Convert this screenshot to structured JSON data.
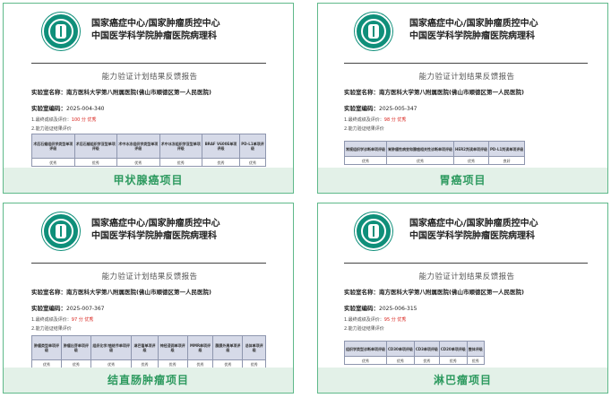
{
  "header": {
    "line1": "国家癌症中心/国家肿瘤质控中心",
    "line2": "中国医学科学院肿瘤医院病理科"
  },
  "report_title": "能力验证计划结果反馈报告",
  "cards": [
    {
      "lab_label": "实验室名称：",
      "lab_name": "南方医科大学第八附属医院(佛山市顺德区第一人民医院)",
      "code_label": "实验室编码：",
      "code": "2025-004-340",
      "score_prefix": "1.最终成绩及评价：",
      "score": "100 分 优秀",
      "eval_label": "2.能力验证结果评价",
      "headers": [
        "术后石蜡组织学类型单项评级",
        "术后石蜡组织学亚型单项评级",
        "术中冰冻组织学类型单项评级",
        "术中冰冻组织学亚型单项评级",
        "BRAF V600E单项评级",
        "PD-L1单项评级"
      ],
      "values": [
        "优秀",
        "优秀",
        "优秀",
        "优秀",
        "优秀",
        "优秀"
      ],
      "caption": "甲状腺癌项目"
    },
    {
      "lab_label": "实验室名称：",
      "lab_name": "南方医科大学第八附属医院(佛山市顺德区第一人民医院)",
      "code_label": "实验室编码：",
      "code": "2025-005-347",
      "score_prefix": "1.最终成绩及评价：",
      "score": "98 分 优秀",
      "eval_label": "2.能力验证结果评价",
      "headers": [
        "常规组织学诊断单项评级",
        "胃肿瘤性病变和腺癌相关性诊断单项评级",
        "HER2判读单项评级",
        "PD-L1判读单项评级"
      ],
      "values": [
        "优秀",
        "优秀",
        "优秀",
        "良好"
      ],
      "caption": "胃癌项目"
    },
    {
      "lab_label": "实验室名称：",
      "lab_name": "南方医科大学第八附属医院(佛山市顺德区第一人民医院)",
      "code_label": "实验室编码：",
      "code": "2025-007-367",
      "score_prefix": "1.最终成绩及评价：",
      "score": "97 分 优秀",
      "eval_label": "2.能力验证结果评价",
      "headers": [
        "肿瘤类型单项评级",
        "肿瘤出芽单项评级",
        "组织化学/癌结节单项评级",
        "淋巴管单项评级",
        "神经浸润单项评级",
        "MMR单项评级",
        "腹膜外周单项评级",
        "总体单项评级"
      ],
      "values": [
        "优秀",
        "优秀",
        "优秀",
        "优秀",
        "优秀",
        "优秀",
        "优秀",
        "优秀"
      ],
      "caption": "结直肠肿瘤项目"
    },
    {
      "lab_label": "实验室名称：",
      "lab_name": "南方医科大学第八附属医院(佛山市顺德区第一人民医院)",
      "code_label": "实验室编码：",
      "code": "2025-006-315",
      "score_prefix": "1.最终成绩及评价：",
      "score": "95 分 优秀",
      "eval_label": "2.能力验证结果评价",
      "headers": [
        "组织学类型诊断单项评级",
        "CD30单项评级",
        "CD3单项评级",
        "CD20单项评级",
        "整体评级"
      ],
      "values": [
        "优秀",
        "优秀",
        "优秀",
        "优秀",
        "优秀"
      ],
      "caption": "淋巴瘤项目"
    }
  ],
  "colors": {
    "accent_green": "#2d9a5f",
    "caption_band": "#e3f1e8",
    "score_red": "#d9231d",
    "table_header": "#d6dae8",
    "logo": "#0f8f7a"
  },
  "icons": {
    "logo": "hospital-emblem-icon"
  }
}
